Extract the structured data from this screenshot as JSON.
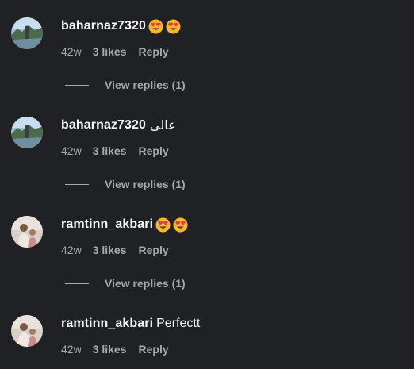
{
  "comments": [
    {
      "username": "baharnaz7320",
      "text": "",
      "emojis": [
        "heart-eyes",
        "heart-eyes"
      ],
      "time": "42w",
      "likes": "3 likes",
      "reply": "Reply",
      "view_replies": "View replies (1)",
      "avatar": "landscape-avatar"
    },
    {
      "username": "baharnaz7320",
      "text": "عالی",
      "emojis": [],
      "time": "42w",
      "likes": "3 likes",
      "reply": "Reply",
      "view_replies": "View replies (1)",
      "avatar": "landscape-avatar"
    },
    {
      "username": "ramtinn_akbari",
      "text": "",
      "emojis": [
        "heart-eyes",
        "heart-eyes"
      ],
      "time": "42w",
      "likes": "3 likes",
      "reply": "Reply",
      "view_replies": "View replies (1)",
      "avatar": "person-avatar"
    },
    {
      "username": "ramtinn_akbari",
      "text": "Perfectt",
      "emojis": [],
      "time": "42w",
      "likes": "3 likes",
      "reply": "Reply",
      "avatar": "person-avatar"
    }
  ],
  "colors": {
    "background": "#202124",
    "primary_text": "#f5f5f5",
    "secondary_text": "#a8a8a8"
  }
}
